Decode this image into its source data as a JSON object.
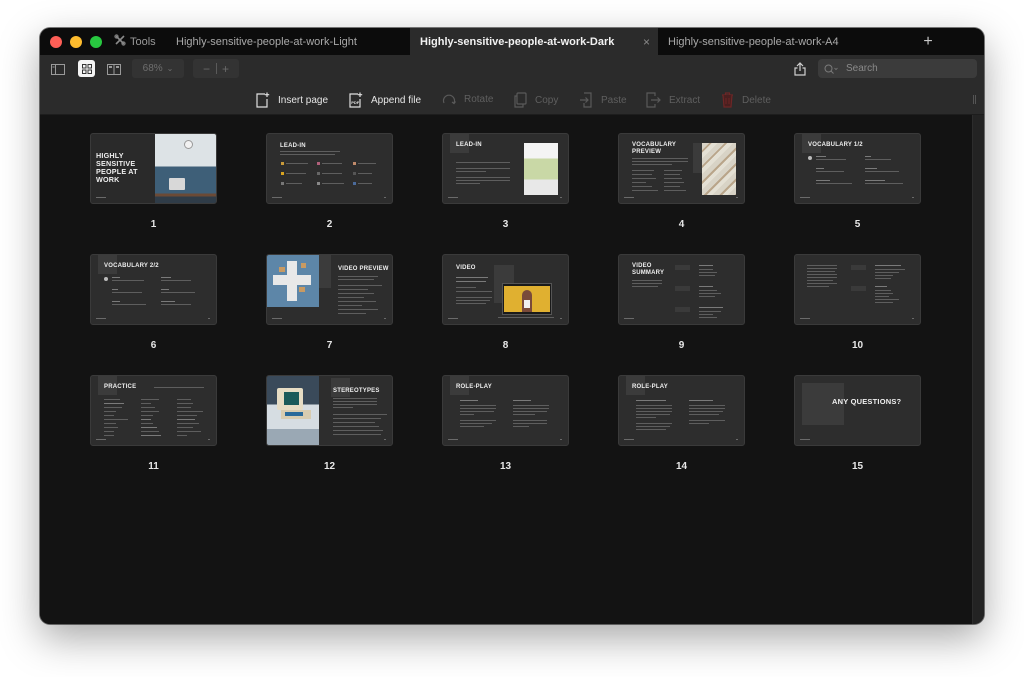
{
  "window": {
    "tools_label": "Tools",
    "tabs": [
      {
        "label": "Highly-sensitive-people-at-work-Light",
        "active": false
      },
      {
        "label": "Highly-sensitive-people-at-work-Dark",
        "active": true
      },
      {
        "label": "Highly-sensitive-people-at-work-A4",
        "active": false
      }
    ],
    "close_glyph": "×",
    "new_tab_glyph": "+"
  },
  "toolbar": {
    "zoom_level": "68%",
    "zoom_out_glyph": "−",
    "zoom_in_glyph": "+",
    "search_placeholder": "Search",
    "selected_view": "grid"
  },
  "actions": [
    {
      "label": "Insert page",
      "icon": "insert-page-icon",
      "enabled": true
    },
    {
      "label": "Append file",
      "icon": "pdf-file-icon",
      "enabled": true
    },
    {
      "label": "Rotate",
      "icon": "rotate-icon",
      "enabled": false
    },
    {
      "label": "Copy",
      "icon": "copy-icon",
      "enabled": false
    },
    {
      "label": "Paste",
      "icon": "paste-icon",
      "enabled": false
    },
    {
      "label": "Extract",
      "icon": "extract-icon",
      "enabled": false
    },
    {
      "label": "Delete",
      "icon": "trash-icon",
      "enabled": false
    }
  ],
  "colors": {
    "delete_icon": "#6e2626",
    "traffic_red": "#fe5f57",
    "traffic_yellow": "#febc2e",
    "traffic_green": "#28c840"
  },
  "pages": [
    {
      "number": "1",
      "title": "HIGHLY SENSITIVE PEOPLE AT WORK"
    },
    {
      "number": "2",
      "title": "LEAD-IN"
    },
    {
      "number": "3",
      "title": "LEAD-IN"
    },
    {
      "number": "4",
      "title": "VOCABULARY PREVIEW"
    },
    {
      "number": "5",
      "title": "VOCABULARY 1/2"
    },
    {
      "number": "6",
      "title": "VOCABULARY 2/2"
    },
    {
      "number": "7",
      "title": "VIDEO PREVIEW"
    },
    {
      "number": "8",
      "title": "VIDEO"
    },
    {
      "number": "9",
      "title": "VIDEO SUMMARY"
    },
    {
      "number": "10",
      "title": ""
    },
    {
      "number": "11",
      "title": "PRACTICE"
    },
    {
      "number": "12",
      "title": "STEREOTYPES"
    },
    {
      "number": "13",
      "title": "ROLE-PLAY"
    },
    {
      "number": "14",
      "title": "ROLE-PLAY"
    },
    {
      "number": "15",
      "title": "ANY QUESTIONS?"
    }
  ]
}
